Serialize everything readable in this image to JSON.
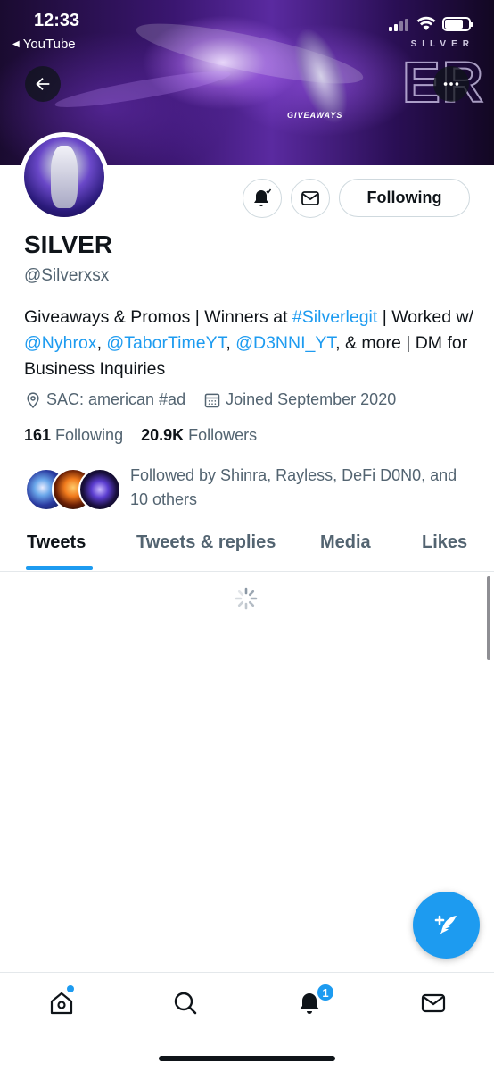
{
  "status_bar": {
    "time": "12:33",
    "back_app": "YouTube"
  },
  "banner": {
    "letters": "ER",
    "small_text": "SILVER",
    "giveaways": "GIVEAWAYS"
  },
  "profile": {
    "display_name": "SILVER",
    "handle": "@Silverxsx",
    "bio": {
      "p1": "Giveaways & Promos | Winners at ",
      "hashtag": "#Silverlegit",
      "p2": " | Worked w/ ",
      "m1": "@Nyhrox",
      "sep1": ", ",
      "m2": "@TaborTimeYT",
      "sep2": ", ",
      "m3": "@D3NNI_YT",
      "p3": ", & more | DM for Business Inquiries"
    },
    "location": "SAC: american #ad",
    "joined": "Joined September 2020",
    "following_count": "161",
    "following_label": "Following",
    "followers_count": "20.9K",
    "followers_label": "Followers",
    "followed_by": "Followed by Shinra, Rayless, DeFi D0N0, and 10 others"
  },
  "actions": {
    "following_button": "Following"
  },
  "tabs": [
    {
      "label": "Tweets",
      "active": true
    },
    {
      "label": "Tweets & replies",
      "active": false
    },
    {
      "label": "Media",
      "active": false
    },
    {
      "label": "Likes",
      "active": false
    }
  ],
  "bottom_nav": {
    "notification_count": "1"
  },
  "colors": {
    "accent": "#1d9bf0",
    "text_primary": "#0f1419",
    "text_secondary": "#536471"
  },
  "icons": [
    "back-arrow-icon",
    "more-icon",
    "bell-icon",
    "mail-icon",
    "location-icon",
    "calendar-icon",
    "compose-icon",
    "home-icon",
    "search-icon",
    "notifications-icon",
    "messages-icon"
  ]
}
